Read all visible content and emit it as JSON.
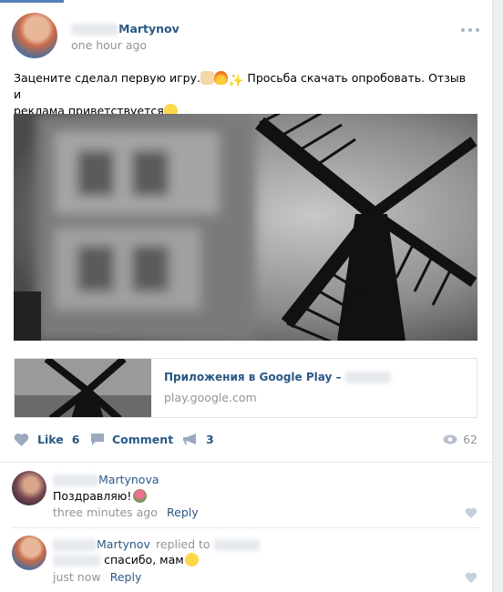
{
  "post": {
    "author_surname": "Martynov",
    "time": "one hour ago",
    "text_line1": "Зацените сделал первую игру.",
    "text_line1b": "Просьба скачать опробовать. Отзыв и",
    "text_line2": "реклама приветствуется",
    "link_title": "Приложения в Google Play –",
    "link_domain": "play.google.com"
  },
  "actions": {
    "like_label": "Like",
    "like_count": "6",
    "comment_label": "Comment",
    "share_count": "3",
    "views_count": "62"
  },
  "comments": [
    {
      "author_surname": "Martynova",
      "text": "Поздравляю!",
      "time": "three minutes ago",
      "reply_label": "Reply"
    },
    {
      "author_surname": "Martynov",
      "replied_to": "replied to",
      "text": "спасибо, мам",
      "time": "just now",
      "reply_label": "Reply"
    }
  ],
  "colors": {
    "accent": "#2a5885",
    "meta": "#939393",
    "icon": "#99a9bf"
  }
}
